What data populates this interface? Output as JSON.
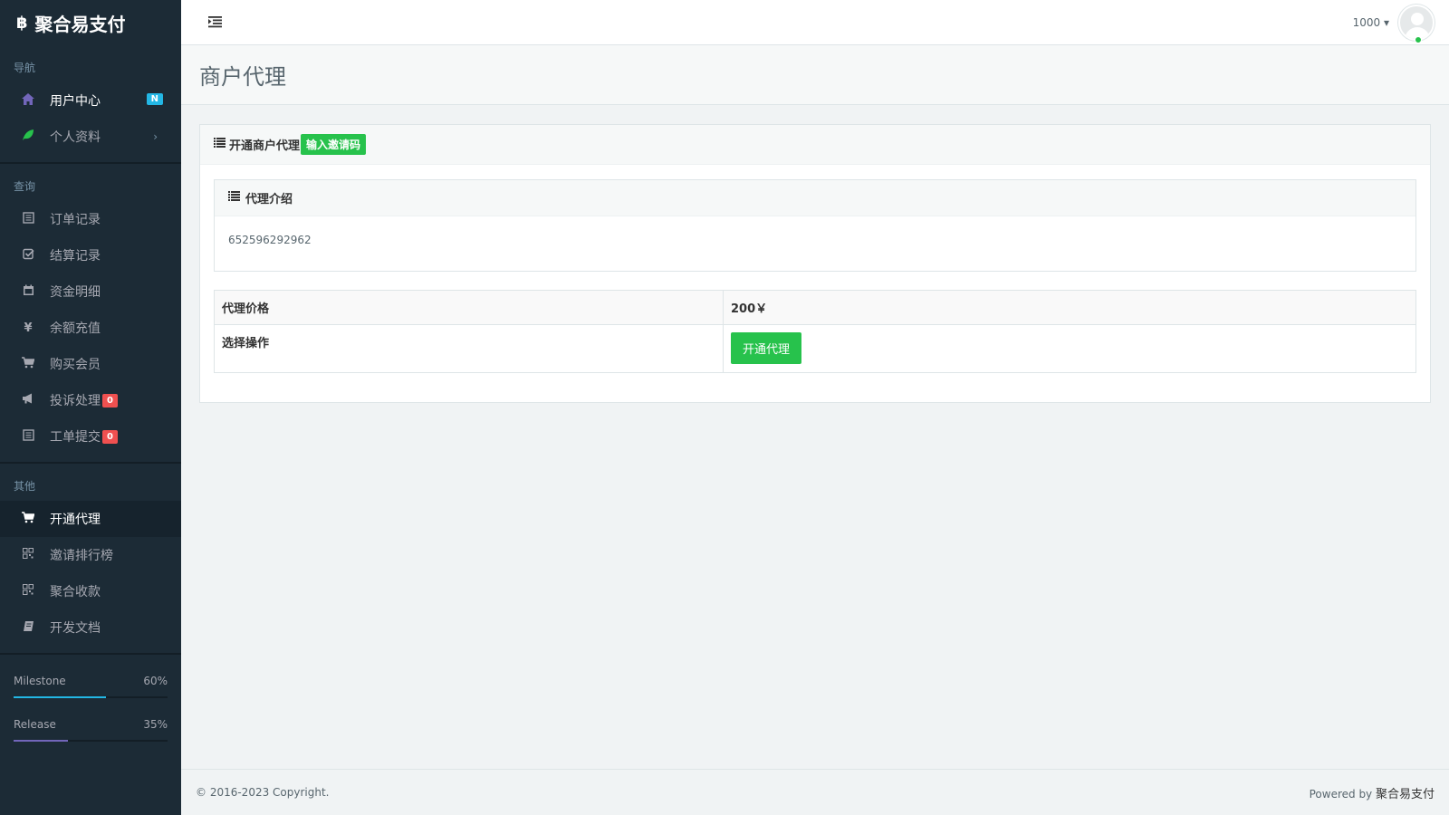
{
  "brand": {
    "logo": "฿",
    "name": "聚合易支付"
  },
  "sidebar": {
    "sections": [
      {
        "header": "导航"
      },
      {
        "header": "查询"
      },
      {
        "header": "其他"
      }
    ],
    "nav": {
      "user_center": {
        "label": "用户中心",
        "badge": "N",
        "icon": "home-icon"
      },
      "profile": {
        "label": "个人资料",
        "chevron": "›",
        "icon": "leaf-icon"
      }
    },
    "query": {
      "orders": {
        "label": "订单记录",
        "icon": "list-icon"
      },
      "settlement": {
        "label": "结算记录",
        "icon": "check-square-icon"
      },
      "funds": {
        "label": "资金明细",
        "icon": "calendar-icon"
      },
      "recharge": {
        "label": "余额充值",
        "icon": "yen-icon"
      },
      "membership": {
        "label": "购买会员",
        "icon": "cart-icon"
      },
      "complaints": {
        "label": "投诉处理",
        "badge": "0",
        "icon": "bullhorn-icon"
      },
      "tickets": {
        "label": "工单提交",
        "badge": "0",
        "icon": "list-icon"
      }
    },
    "other": {
      "agent": {
        "label": "开通代理",
        "icon": "cart-icon"
      },
      "invite_rank": {
        "label": "邀请排行榜",
        "icon": "qrcode-icon"
      },
      "aggregate": {
        "label": "聚合收款",
        "icon": "qrcode-icon"
      },
      "docs": {
        "label": "开发文档",
        "icon": "book-icon"
      }
    },
    "progress": [
      {
        "label": "Milestone",
        "percent_text": "60%",
        "value": 0.6,
        "color": "#23b7e5"
      },
      {
        "label": "Release",
        "percent_text": "35%",
        "value": 0.35,
        "color": "#7266ba"
      }
    ]
  },
  "header": {
    "menu_toggle_icon": "menu-toggle-icon",
    "user_name": "1000",
    "caret": "▾"
  },
  "page": {
    "title": "商户代理"
  },
  "panel": {
    "title": "开通商户代理",
    "invite_button": "输入邀请码",
    "intro": {
      "title": "代理介绍",
      "body": "652596292962"
    },
    "table": {
      "price_label": "代理价格",
      "price_value": "200￥",
      "action_label": "选择操作",
      "action_button": "开通代理"
    }
  },
  "footer": {
    "copyright": "© 2016-2023 Copyright.",
    "powered_prefix": "Powered by ",
    "powered_brand": "聚合易支付"
  },
  "colors": {
    "sidebar_bg": "#1c2b36",
    "success": "#27c24c",
    "info": "#23b7e5",
    "danger": "#f05050",
    "accent": "#7266ba"
  }
}
